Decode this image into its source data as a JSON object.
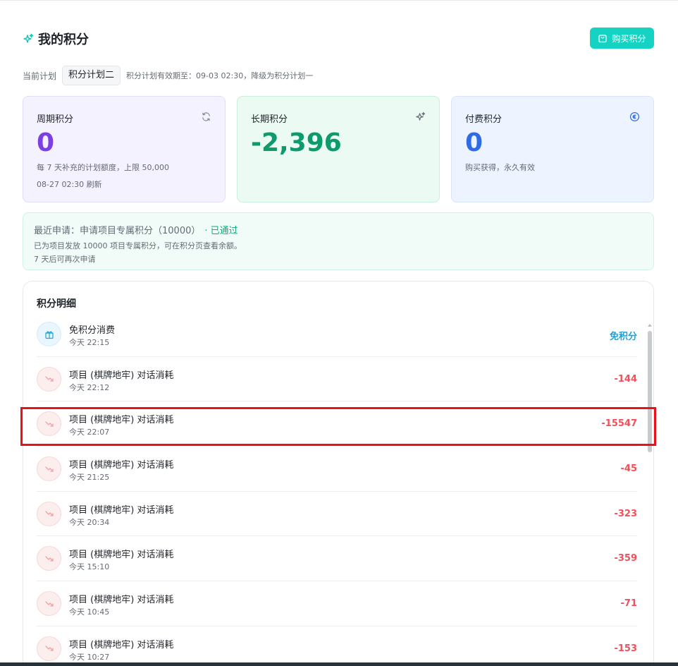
{
  "header": {
    "title": "我的积分",
    "buy_button": "购买积分"
  },
  "plan": {
    "label": "当前计划",
    "current": "积分计划二",
    "note": "积分计划有效期至：09-03 02:30，降级为积分计划一"
  },
  "cards": {
    "periodic": {
      "label": "周期积分",
      "value": "0",
      "desc": "每 7 天补充的计划额度，上限 50,000",
      "refresh": "08-27 02:30 刷新",
      "icon": "refresh-icon"
    },
    "longterm": {
      "label": "长期积分",
      "value": "-2,396",
      "icon": "sparkle-icon"
    },
    "paid": {
      "label": "付费积分",
      "value": "0",
      "desc": "购买获得，永久有效",
      "icon": "coin-icon"
    }
  },
  "application": {
    "line1": "最近申请：申请项目专属积分（10000）",
    "status": "· 已通过",
    "line2": "已为项目发放 10000 项目专属积分，可在积分页查看余额。",
    "line3": "7 天后可再次申请"
  },
  "detail": {
    "title": "积分明细",
    "rows": [
      {
        "title": "免积分消费",
        "time": "今天 22:15",
        "amount": "免积分",
        "icon": "gift-icon"
      },
      {
        "title": "项目 (棋牌地牢) 对话消耗",
        "time": "今天 22:12",
        "amount": "-144",
        "icon": "trend-down-icon"
      },
      {
        "title": "项目 (棋牌地牢) 对话消耗",
        "time": "今天 22:07",
        "amount": "-15547",
        "icon": "trend-down-icon"
      },
      {
        "title": "项目 (棋牌地牢) 对话消耗",
        "time": "今天 21:25",
        "amount": "-45",
        "icon": "trend-down-icon"
      },
      {
        "title": "项目 (棋牌地牢) 对话消耗",
        "time": "今天 20:34",
        "amount": "-323",
        "icon": "trend-down-icon"
      },
      {
        "title": "项目 (棋牌地牢) 对话消耗",
        "time": "今天 15:10",
        "amount": "-359",
        "icon": "trend-down-icon"
      },
      {
        "title": "项目 (棋牌地牢) 对话消耗",
        "time": "今天 10:45",
        "amount": "-71",
        "icon": "trend-down-icon"
      },
      {
        "title": "项目 (棋牌地牢) 对话消耗",
        "time": "今天 10:27",
        "amount": "-153",
        "icon": "trend-down-icon"
      }
    ]
  },
  "colors": {
    "accent": "#14d3c2",
    "purple": "#7b3fe4",
    "green": "#0f9a6e",
    "blue": "#2f6be5",
    "negative": "#f0505a",
    "free": "#1aa3d9",
    "highlight": "#e8121d"
  }
}
